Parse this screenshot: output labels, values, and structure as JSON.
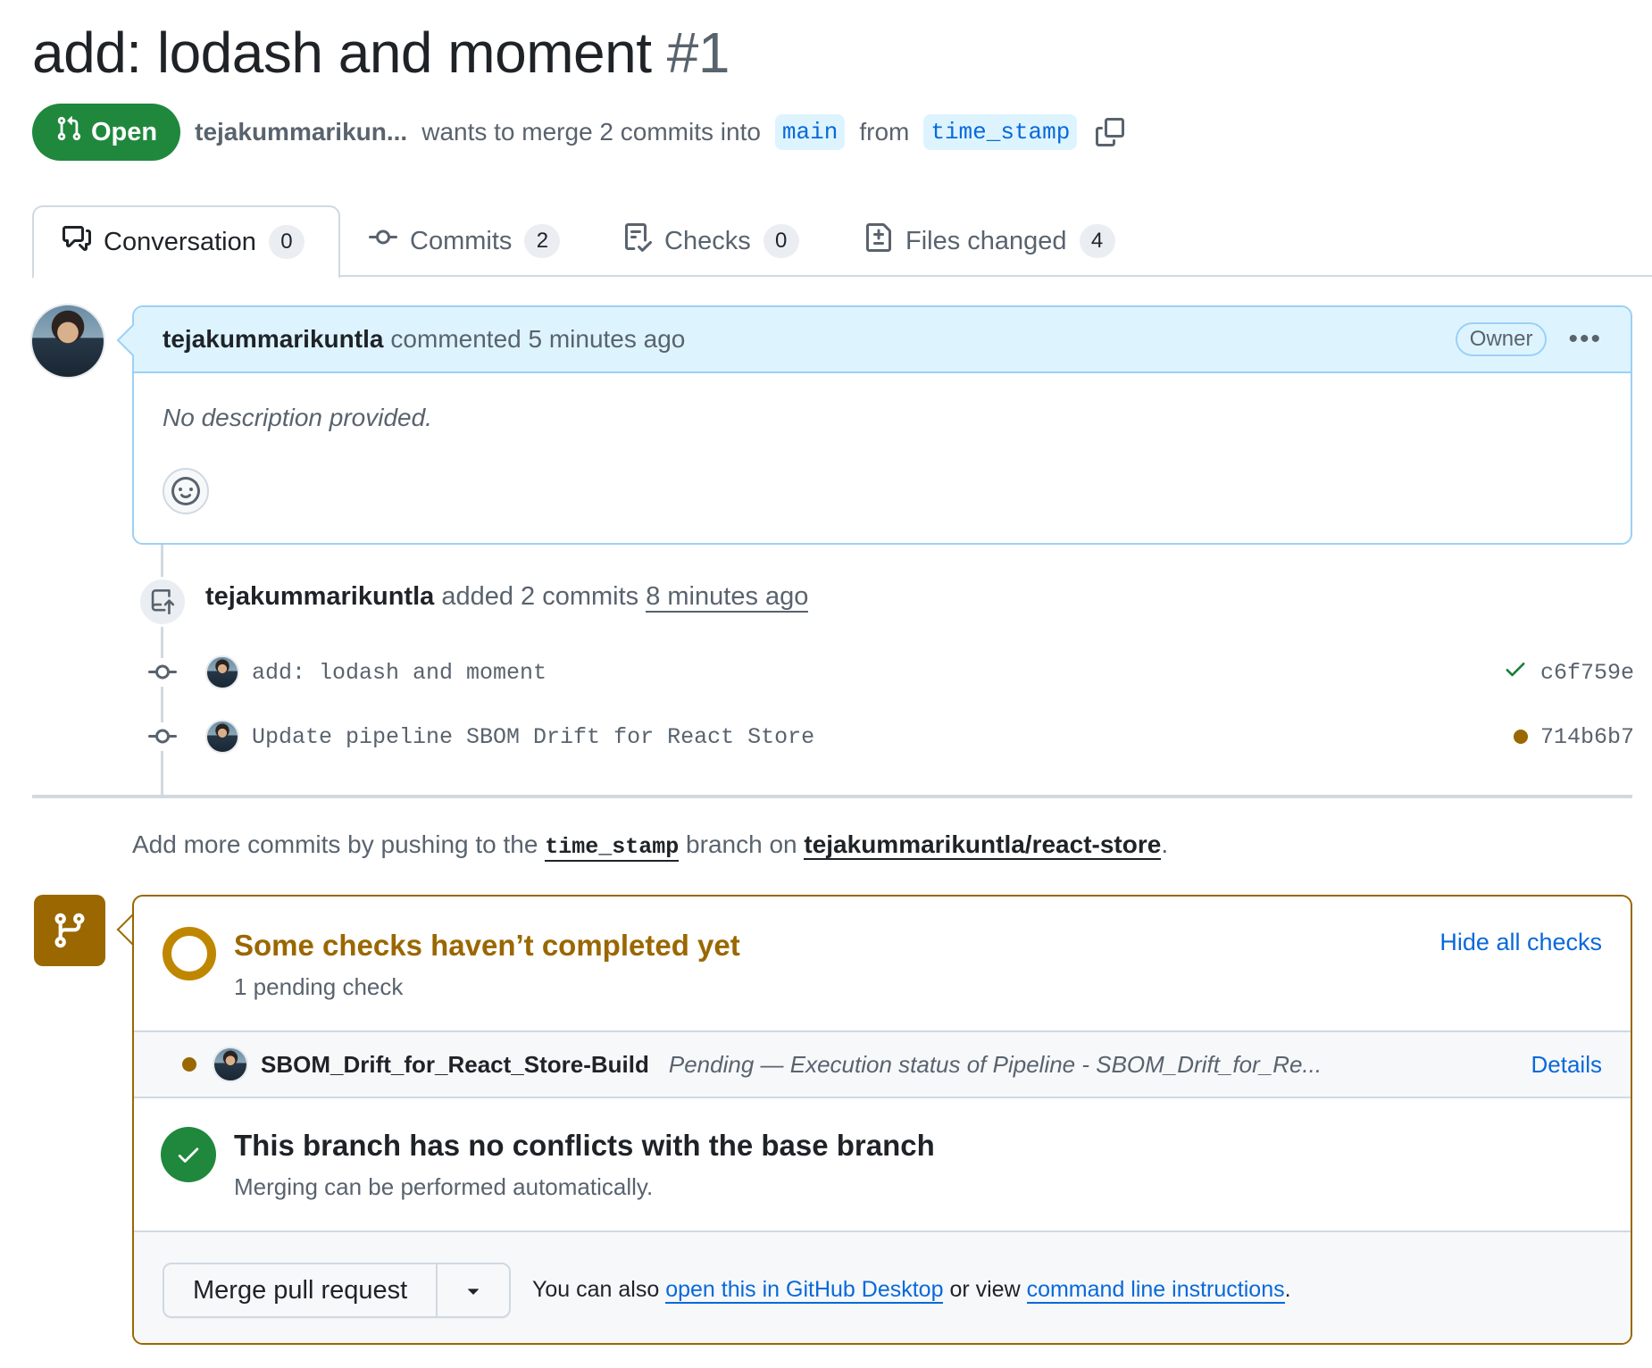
{
  "pr": {
    "title": "add: lodash and moment",
    "number": "#1",
    "state": "Open",
    "author_truncated": "tejakummarikun...",
    "merge_text": "wants to merge 2 commits into",
    "base_branch": "main",
    "from_text": "from",
    "head_branch": "time_stamp"
  },
  "tabs": [
    {
      "label": "Conversation",
      "count": "0",
      "icon": "comment-discussion-icon"
    },
    {
      "label": "Commits",
      "count": "2",
      "icon": "git-commit-icon"
    },
    {
      "label": "Checks",
      "count": "0",
      "icon": "checklist-icon"
    },
    {
      "label": "Files changed",
      "count": "4",
      "icon": "file-diff-icon"
    }
  ],
  "comment": {
    "author": "tejakummarikuntla",
    "action": "commented 5 minutes ago",
    "badge": "Owner",
    "body": "No description provided."
  },
  "event": {
    "author": "tejakummarikuntla",
    "action": "added 2 commits",
    "time": "8 minutes ago"
  },
  "commits": [
    {
      "message": "add: lodash and moment",
      "sha": "c6f759e",
      "status": "success"
    },
    {
      "message": "Update pipeline SBOM Drift for React Store",
      "sha": "714b6b7",
      "status": "pending"
    }
  ],
  "hint": {
    "prefix": "Add more commits by pushing to the",
    "branch": "time_stamp",
    "middle": "branch on",
    "repo": "tejakummarikuntla/react-store",
    "suffix": "."
  },
  "merge_box": {
    "checks_title": "Some checks haven’t completed yet",
    "checks_sub": "1 pending check",
    "hide_link": "Hide all checks",
    "check": {
      "name": "SBOM_Drift_for_React_Store-Build",
      "desc": "Pending — Execution status of Pipeline - SBOM_Drift_for_Re...",
      "details": "Details"
    },
    "conflict_title": "This branch has no conflicts with the base branch",
    "conflict_sub": "Merging can be performed automatically.",
    "merge_button": "Merge pull request",
    "also_prefix": "You can also",
    "desktop_link": "open this in GitHub Desktop",
    "also_middle": "or view",
    "cli_link": "command line instructions",
    "also_suffix": "."
  },
  "colors": {
    "open_green": "#1f883d",
    "pending_yellow": "#9a6700",
    "link_blue": "#0969da"
  }
}
